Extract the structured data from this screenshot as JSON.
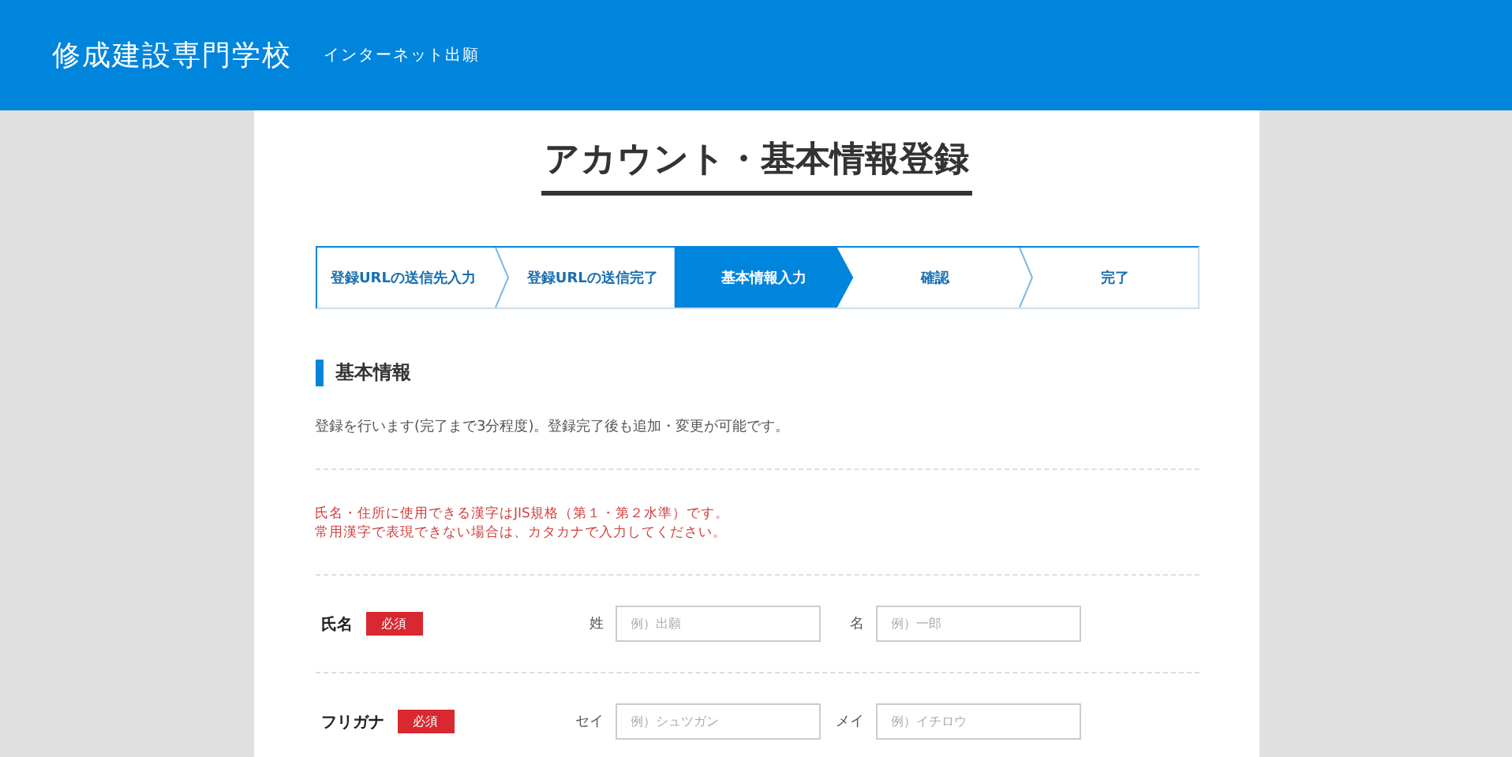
{
  "header": {
    "school": "修成建設専門学校",
    "subtitle": "インターネット出願"
  },
  "page_title": "アカウント・基本情報登録",
  "steps": [
    {
      "label": "登録URLの送信先入力",
      "selected": false
    },
    {
      "label": "登録URLの送信完了",
      "selected": false
    },
    {
      "label": "基本情報入力",
      "selected": true
    },
    {
      "label": "確認",
      "selected": false
    },
    {
      "label": "完了",
      "selected": false
    }
  ],
  "section": {
    "heading": "基本情報",
    "intro": "登録を行います(完了まで3分程度)。登録完了後も追加・変更が可能です。",
    "notes": [
      "氏名・住所に使用できる漢字はJIS規格（第１・第２水準）です。",
      "常用漢字で表現できない場合は、カタカナで入力してください。"
    ]
  },
  "fields": [
    {
      "label": "氏名",
      "badge": "必須",
      "inputs": [
        {
          "label": "姓",
          "placeholder": "例）出願"
        },
        {
          "label": "名",
          "placeholder": "例）一郎"
        }
      ]
    },
    {
      "label": "フリガナ",
      "badge": "必須",
      "inputs": [
        {
          "label": "セイ",
          "placeholder": "例）シュツガン"
        },
        {
          "label": "メイ",
          "placeholder": "例）イチロウ"
        }
      ]
    }
  ]
}
